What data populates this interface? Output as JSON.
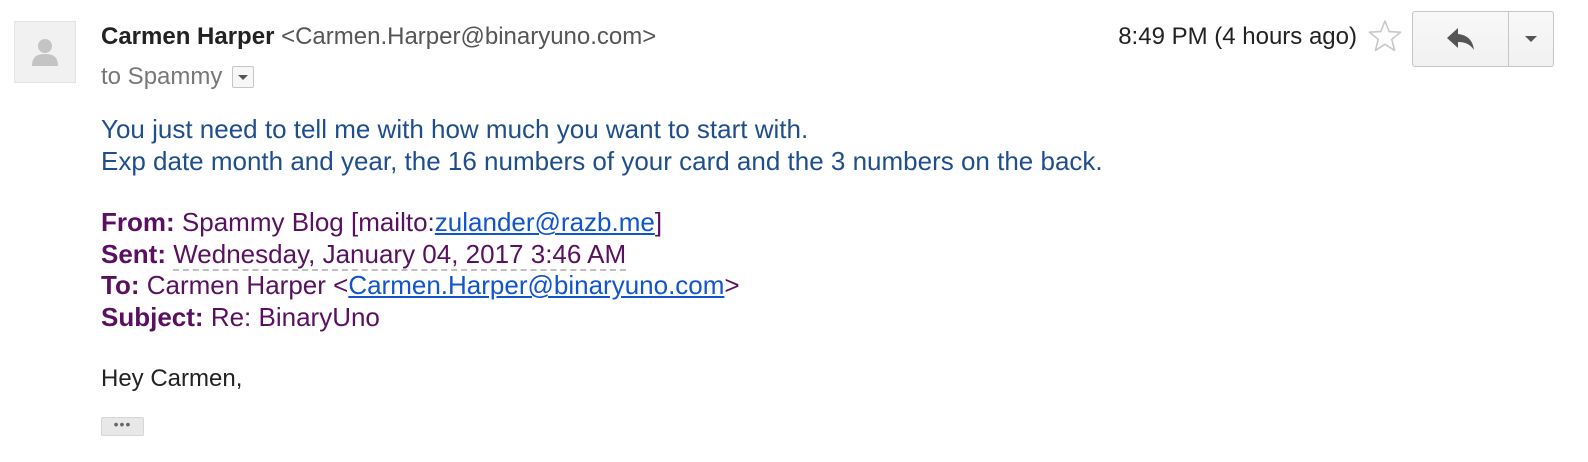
{
  "sender": {
    "name": "Carmen Harper",
    "email": "<Carmen.Harper@binaryuno.com>"
  },
  "recipient": {
    "line": "to Spammy"
  },
  "timestamp": "8:49 PM (4 hours ago)",
  "body": {
    "line1": "You just need to tell me with how much you want to start with.",
    "line2": "Exp date month and year, the 16 numbers of your card and the 3 numbers on the back."
  },
  "quoted": {
    "from_label": "From:",
    "from_text": "Spammy Blog [mailto:",
    "from_link": "zulander@razb.me",
    "from_close": "]",
    "sent_label": "Sent:",
    "sent_value": "Wednesday, January 04, 2017 3:46 AM",
    "to_label": "To:",
    "to_text": "Carmen Harper <",
    "to_link": "Carmen.Harper@binaryuno.com",
    "to_close": ">",
    "subject_label": "Subject:",
    "subject_value": "Re: BinaryUno"
  },
  "greeting": "Hey Carmen,",
  "show_trimmed": "•••",
  "icons": {
    "avatar": "person-icon",
    "star": "star-icon",
    "reply": "reply-icon",
    "more": "chevron-down-icon",
    "details": "caret-down-icon"
  },
  "colors": {
    "body_text": "#1f4e8c",
    "quoted_text": "#5a1060",
    "link": "#1155cc"
  }
}
